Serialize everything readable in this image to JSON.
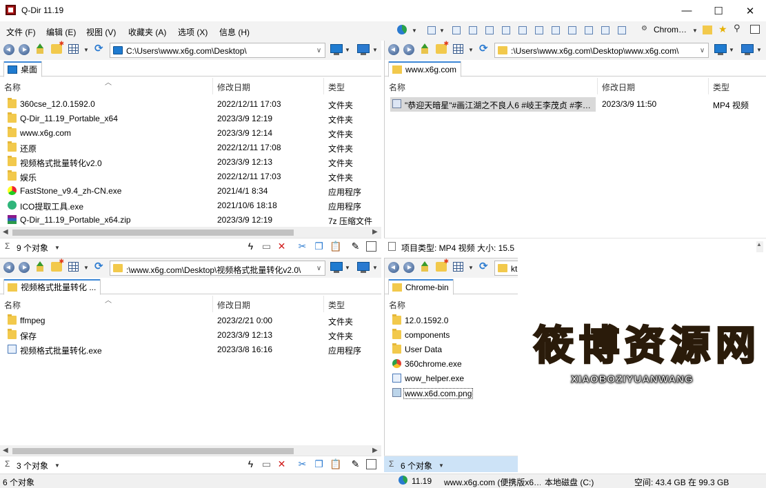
{
  "window": {
    "title": "Q-Dir 11.19",
    "minimize": "—",
    "maximize": "☐",
    "close": "✕"
  },
  "menu": [
    "文件 (F)",
    "编辑 (E)",
    "视图 (V)",
    "收藏夹 (A)",
    "选项 (X)",
    "信息 (H)"
  ],
  "toolbar_right": {
    "browser_label": "Chrom…"
  },
  "columns": {
    "name": "名称",
    "modified": "修改日期",
    "type": "类型"
  },
  "pane_tl": {
    "address": "C:\\Users\\www.x6g.com\\Desktop\\",
    "tab": "桌面",
    "items": [
      {
        "name": "360cse_12.0.1592.0",
        "date": "2022/12/11 17:03",
        "type": "文件夹",
        "icon": "folder"
      },
      {
        "name": "Q-Dir_11.19_Portable_x64",
        "date": "2023/3/9 12:19",
        "type": "文件夹",
        "icon": "folder"
      },
      {
        "name": "www.x6g.com",
        "date": "2023/3/9 12:14",
        "type": "文件夹",
        "icon": "folder"
      },
      {
        "name": "还原",
        "date": "2022/12/11 17:08",
        "type": "文件夹",
        "icon": "folder"
      },
      {
        "name": "视频格式批量转化v2.0",
        "date": "2023/3/9 12:13",
        "type": "文件夹",
        "icon": "folder"
      },
      {
        "name": "娱乐",
        "date": "2022/12/11 17:03",
        "type": "文件夹",
        "icon": "folder"
      },
      {
        "name": "FastStone_v9.4_zh-CN.exe",
        "date": "2021/4/1 8:34",
        "type": "应用程序",
        "icon": "faststone"
      },
      {
        "name": "ICO提取工具.exe",
        "date": "2021/10/6 18:18",
        "type": "应用程序",
        "icon": "ico-tool"
      },
      {
        "name": "Q-Dir_11.19_Portable_x64.zip",
        "date": "2023/3/9 12:19",
        "type": "7z 压缩文件",
        "icon": "zip"
      }
    ],
    "status": "9 个对象"
  },
  "pane_tr": {
    "address": ":\\Users\\www.x6g.com\\Desktop\\www.x6g.com\\",
    "tab": "www.x6g.com",
    "items": [
      {
        "name": "\"恭迎天暗星\"#画江湖之不良人6 #岐王李茂贞 #李…",
        "date": "2023/3/9 11:50",
        "type": "MP4 视频",
        "icon": "mp4"
      }
    ],
    "status": "项目类型: MP4 视频 大小: 15.5"
  },
  "pane_bl": {
    "address": ":\\www.x6g.com\\Desktop\\视频格式批量转化v2.0\\",
    "tab": "视频格式批量转化 ...",
    "items": [
      {
        "name": "ffmpeg",
        "date": "2023/2/21 0:00",
        "type": "文件夹",
        "icon": "folder"
      },
      {
        "name": "保存",
        "date": "2023/3/9 12:13",
        "type": "文件夹",
        "icon": "folder"
      },
      {
        "name": "视频格式批量转化.exe",
        "date": "2023/3/8 16:16",
        "type": "应用程序",
        "icon": "exe"
      }
    ],
    "status": "3 个对象"
  },
  "pane_br": {
    "address": "kt",
    "tab": "Chrome-bin",
    "items": [
      {
        "name": "12.0.1592.0",
        "icon": "folder"
      },
      {
        "name": "components",
        "icon": "folder"
      },
      {
        "name": "User Data",
        "icon": "folder"
      },
      {
        "name": "360chrome.exe",
        "icon": "chrome"
      },
      {
        "name": "wow_helper.exe",
        "icon": "exe"
      },
      {
        "name": "www.x6d.com.png",
        "icon": "png"
      }
    ],
    "status": "6 个对象"
  },
  "watermark": {
    "chars": [
      "筱",
      "博",
      "资",
      "源",
      "网"
    ],
    "sub": "XIAOBOZIYUANWANG"
  },
  "bottom": {
    "left": "6 个对象",
    "version": "11.19",
    "site": "www.x6g.com (便携版x6…",
    "drive": "本地磁盘 (C:)",
    "space": "空间: 43.4 GB 在 99.3 GB"
  },
  "colors": {
    "accent": "#3b86d6",
    "folder": "#f2c94c",
    "selected_status": "#cde3f7"
  }
}
